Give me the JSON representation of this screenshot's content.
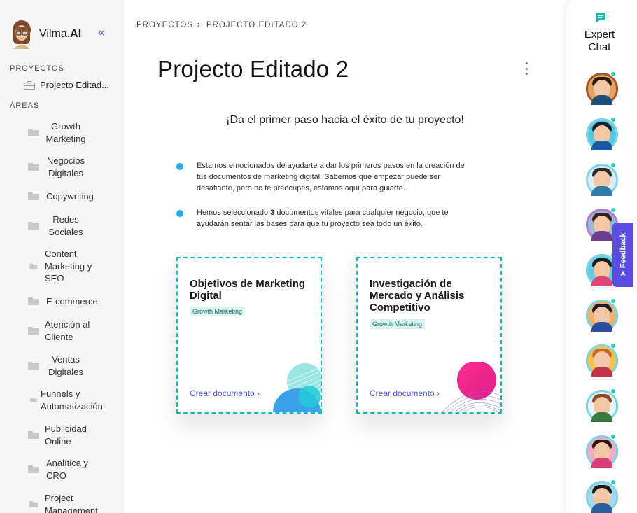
{
  "brand": {
    "name_plain": "Vilma.",
    "name_bold": "AI",
    "collapse_icon": "double-chevron-left-icon"
  },
  "sidebar": {
    "projects_label": "PROYECTOS",
    "project_item": "Projecto Editad...",
    "areas_label": "ÁREAS",
    "areas": [
      "Growth Marketing",
      "Negocios Digitales",
      "Copywriting",
      "Redes Sociales",
      "Content Marketing y SEO",
      "E-commerce",
      "Atención al Cliente",
      "Ventas Digitales",
      "Funnels y Automatización",
      "Publicidad Online",
      "Analítica y CRO",
      "Project Management"
    ]
  },
  "breadcrumb": {
    "root": "PROYECTOS",
    "current": "PROJECTO EDITADO 2"
  },
  "page": {
    "title": "Projecto Editado 2",
    "subtitle": "¡Da el primer paso hacia el éxito de tu proyecto!",
    "bullet1": "Estamos emocionados de ayudarte a dar los primeros pasos en la creación de tus documentos de marketing digital. Sabemos que empezar puede ser desafiante, pero no te preocupes, estamos aquí para guiarte.",
    "bullet2_pre": "Hemos seleccionado ",
    "bullet2_bold": "3",
    "bullet2_post": " documentos vitales para cualquier negocio, que te ayudarán sentar las bases para que tu proyecto sea todo un éxito."
  },
  "cards": [
    {
      "title": "Objetivos de Marketing Digital",
      "tag": "Growth Marketing",
      "link": "Crear documento ›"
    },
    {
      "title": "Investigación de Mercado y Análisis Competitivo",
      "tag": "Growth Marketing",
      "link": "Crear documento ›"
    }
  ],
  "right_panel": {
    "title": "Expert Chat",
    "icon": "chat-icon",
    "expert_count": 10
  },
  "feedback": {
    "label": "Feedback",
    "icon": "send-icon"
  },
  "colors": {
    "accent": "#5b4de0",
    "teal": "#18b5c6",
    "bullet": "#2aa8e0"
  }
}
